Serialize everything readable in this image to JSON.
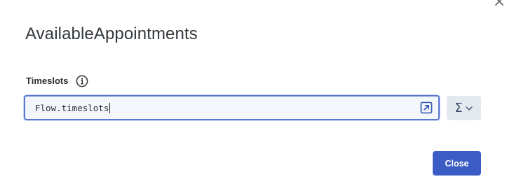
{
  "dialog": {
    "title": "AvailableAppointments",
    "close_icon": "close-icon"
  },
  "field": {
    "label": "Timeslots",
    "info_icon": "info-icon",
    "value": "Flow.timeslots",
    "expand_icon": "expand-editor-icon"
  },
  "expression_menu": {
    "icon": "sigma-icon",
    "glyph": "Σ",
    "chevron_icon": "chevron-down-icon"
  },
  "footer": {
    "close_label": "Close"
  },
  "colors": {
    "accent": "#3a5cc4",
    "input_border": "#5a77d1",
    "input_bg": "#f3f6fb",
    "sigma_bg": "#e4e8ef"
  }
}
